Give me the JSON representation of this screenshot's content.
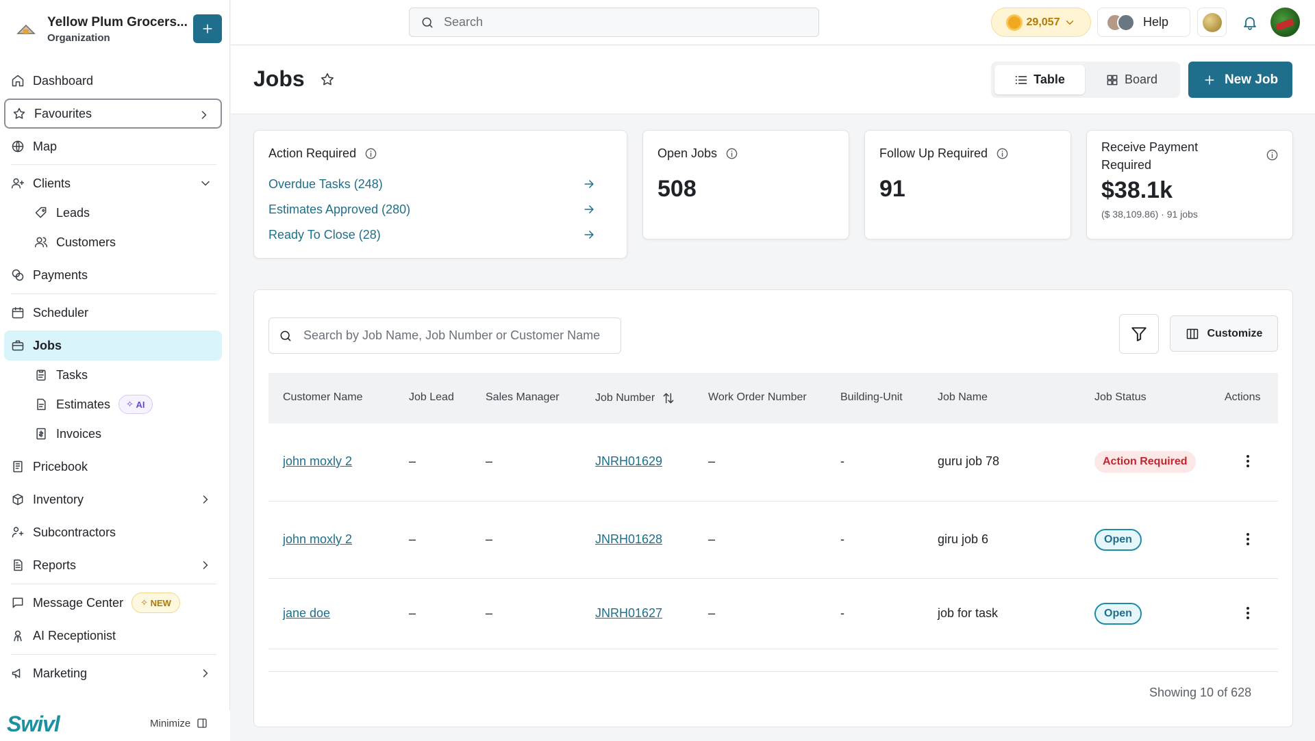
{
  "org": {
    "name": "Yellow Plum Grocers...",
    "subtitle": "Organization"
  },
  "sidebar": {
    "items": [
      {
        "label": "Dashboard"
      },
      {
        "label": "Favourites"
      },
      {
        "label": "Map"
      },
      {
        "label": "Clients"
      },
      {
        "label": "Leads"
      },
      {
        "label": "Customers"
      },
      {
        "label": "Payments"
      },
      {
        "label": "Scheduler"
      },
      {
        "label": "Jobs"
      },
      {
        "label": "Tasks"
      },
      {
        "label": "Estimates",
        "badge": "AI"
      },
      {
        "label": "Invoices"
      },
      {
        "label": "Pricebook"
      },
      {
        "label": "Inventory"
      },
      {
        "label": "Subcontractors"
      },
      {
        "label": "Reports"
      },
      {
        "label": "Message Center",
        "badge": "NEW"
      },
      {
        "label": "AI Receptionist"
      },
      {
        "label": "Marketing"
      }
    ],
    "brand": "Swivl",
    "minimize_label": "Minimize"
  },
  "topbar": {
    "search_placeholder": "Search",
    "credits": "29,057",
    "help_label": "Help"
  },
  "page": {
    "title": "Jobs",
    "view_table": "Table",
    "view_board": "Board",
    "new_job_label": "New Job"
  },
  "summary": {
    "action_required": {
      "title": "Action Required",
      "links": [
        {
          "label": "Overdue Tasks (248)"
        },
        {
          "label": "Estimates Approved (280)"
        },
        {
          "label": "Ready To Close (28)"
        }
      ]
    },
    "open_jobs": {
      "title": "Open Jobs",
      "value": "508"
    },
    "follow_up": {
      "title": "Follow Up Required",
      "value": "91"
    },
    "receive_payment": {
      "title_line1": "Receive Payment",
      "title_line2": "Required",
      "value": "$38.1k",
      "sub": "($ 38,109.86) · 91 jobs"
    }
  },
  "table": {
    "search_placeholder": "Search by Job Name, Job Number or Customer Name",
    "customize_label": "Customize",
    "columns": [
      "Customer Name",
      "Job Lead",
      "Sales Manager",
      "Job Number",
      "Work Order Number",
      "Building-Unit",
      "Job Name",
      "Job Status",
      "Actions"
    ],
    "rows": [
      {
        "customer": "john moxly 2",
        "lead": "–",
        "manager": "–",
        "number": "JNRH01629",
        "work_order": "–",
        "unit": "-",
        "name": "guru job 78",
        "status": "Action Required",
        "status_kind": "action"
      },
      {
        "customer": "john moxly 2",
        "lead": "–",
        "manager": "–",
        "number": "JNRH01628",
        "work_order": "–",
        "unit": "-",
        "name": "giru job 6",
        "status": "Open",
        "status_kind": "open"
      },
      {
        "customer": "jane doe",
        "lead": "–",
        "manager": "–",
        "number": "JNRH01627",
        "work_order": "–",
        "unit": "-",
        "name": "job for task",
        "status": "Open",
        "status_kind": "open"
      }
    ],
    "showing": "Showing 10 of 628"
  },
  "colors": {
    "accent": "#1f6e8c",
    "active_nav": "#d9f4fb",
    "danger": "#c4262e",
    "credits": "#b57900"
  },
  "icons": [
    "plus-icon",
    "search-icon",
    "chevron-down-icon",
    "bell-icon",
    "star-icon",
    "list-icon",
    "grid-icon",
    "info-icon",
    "arrow-right-icon",
    "filter-icon",
    "columns-icon",
    "sort-icon",
    "kebab-icon"
  ]
}
